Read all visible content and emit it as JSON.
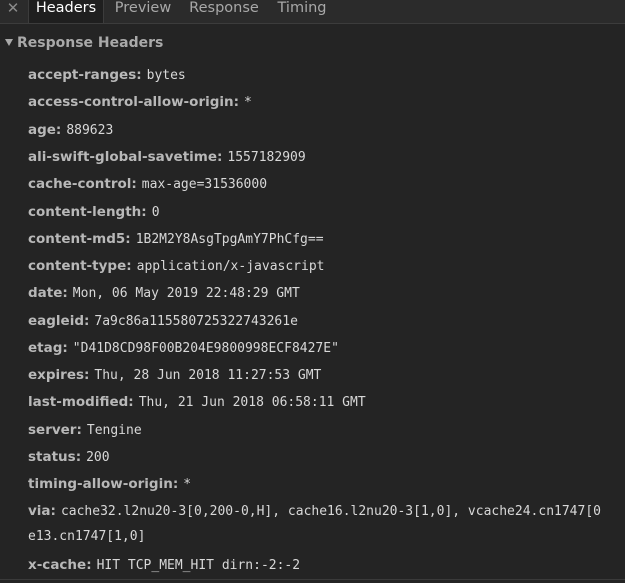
{
  "tabs": {
    "close": "✕",
    "items": [
      "Headers",
      "Preview",
      "Response",
      "Timing"
    ],
    "active": "Headers"
  },
  "section": {
    "title": "Response Headers"
  },
  "headers": [
    {
      "key": "accept-ranges:",
      "value": "bytes"
    },
    {
      "key": "access-control-allow-origin:",
      "value": "*"
    },
    {
      "key": "age:",
      "value": "889623"
    },
    {
      "key": "ali-swift-global-savetime:",
      "value": "1557182909"
    },
    {
      "key": "cache-control:",
      "value": "max-age=31536000"
    },
    {
      "key": "content-length:",
      "value": "0"
    },
    {
      "key": "content-md5:",
      "value": "1B2M2Y8AsgTpgAmY7PhCfg=="
    },
    {
      "key": "content-type:",
      "value": "application/x-javascript"
    },
    {
      "key": "date:",
      "value": "Mon, 06 May 2019 22:48:29 GMT"
    },
    {
      "key": "eagleid:",
      "value": "7a9c86a115580725322743261e"
    },
    {
      "key": "etag:",
      "value": "\"D41D8CD98F00B204E9800998ECF8427E\""
    },
    {
      "key": "expires:",
      "value": "Thu, 28 Jun 2018 11:27:53 GMT"
    },
    {
      "key": "last-modified:",
      "value": "Thu, 21 Jun 2018 06:58:11 GMT"
    },
    {
      "key": "server:",
      "value": "Tengine"
    },
    {
      "key": "status:",
      "value": "200"
    },
    {
      "key": "timing-allow-origin:",
      "value": "*"
    },
    {
      "key": "via:",
      "value": "cache32.l2nu20-3[0,200-0,H], cache16.l2nu20-3[1,0], vcache24.cn1747[0"
    },
    {
      "key": "x-cache:",
      "value": "HIT TCP_MEM_HIT dirn:-2:-2"
    }
  ],
  "via_continuation": "e13.cn1747[1,0]"
}
